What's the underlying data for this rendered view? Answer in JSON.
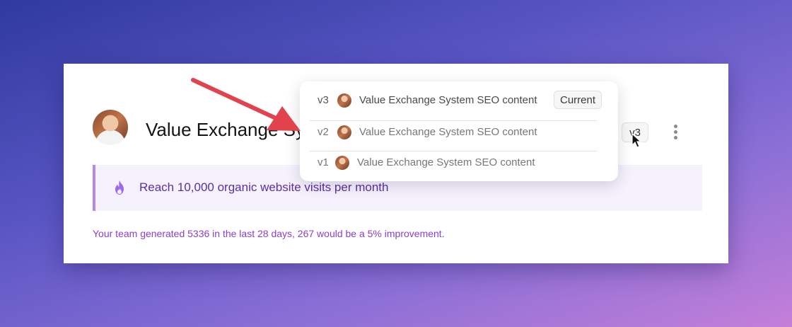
{
  "goal_card": {
    "title": "Value Exchange Sy",
    "version_chip": "v3",
    "goal_text": "Reach 10,000 organic website visits per month",
    "footnote": "Your team generated 5336 in the last 28 days, 267 would be a 5% improvement."
  },
  "version_menu": {
    "items": [
      {
        "version": "v3",
        "label": "Value Exchange System SEO content",
        "badge": "Current"
      },
      {
        "version": "v2",
        "label": "Value Exchange System SEO content"
      },
      {
        "version": "v1",
        "label": "Value Exchange System SEO content"
      }
    ]
  },
  "colors": {
    "accent": "#b48ae6",
    "goal_text": "#5b2fa6",
    "arrow": "#e2424d"
  },
  "icons": {
    "goal": "fire-icon",
    "more": "more-vertical-icon",
    "cursor": "pointer-cursor-icon"
  }
}
